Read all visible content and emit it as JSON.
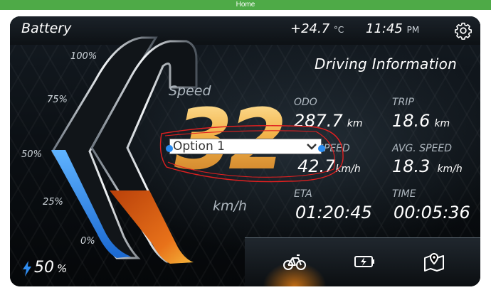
{
  "window": {
    "title": "Home"
  },
  "header": {
    "battery_label": "Battery",
    "temperature": "+24.7",
    "temperature_unit": "°C",
    "time": "11:45",
    "time_period": "PM",
    "settings_icon": "gear-icon"
  },
  "section_title": "Driving Information",
  "speed": {
    "label": "Speed",
    "value": "32",
    "unit": "km/h"
  },
  "stats": {
    "odo": {
      "label": "ODO",
      "value": "287.7",
      "unit": "km"
    },
    "trip": {
      "label": "TRIP",
      "value": "18.6",
      "unit": "km"
    },
    "speed": {
      "label": "SPEED",
      "value": "42.7",
      "unit": "km/h"
    },
    "avg_speed": {
      "label": "AVG. SPEED",
      "value": "18.3",
      "unit": "km/h"
    },
    "eta": {
      "label": "ETA",
      "value": "01:20:45"
    },
    "time": {
      "label": "TIME",
      "value": "00:05:36"
    }
  },
  "battery_gauge": {
    "ticks": [
      "100%",
      "75%",
      "50%",
      "25%",
      "0%"
    ],
    "level_percent": 50,
    "level_text": "50",
    "level_unit": "%"
  },
  "overlay_select": {
    "selected": "Option 1"
  },
  "bottom_nav": {
    "items": [
      {
        "name": "bicycle-icon",
        "active": true
      },
      {
        "name": "battery-charging-icon",
        "active": false
      },
      {
        "name": "map-icon",
        "active": false
      }
    ]
  },
  "colors": {
    "accent_gold": "#f2b34a",
    "battery_blue": "#2f8cf0",
    "power_orange": "#d85a10",
    "titlebar_green": "#4eaa47",
    "highlight_blue": "#2a8cf0",
    "annotation_red": "#e02020"
  }
}
